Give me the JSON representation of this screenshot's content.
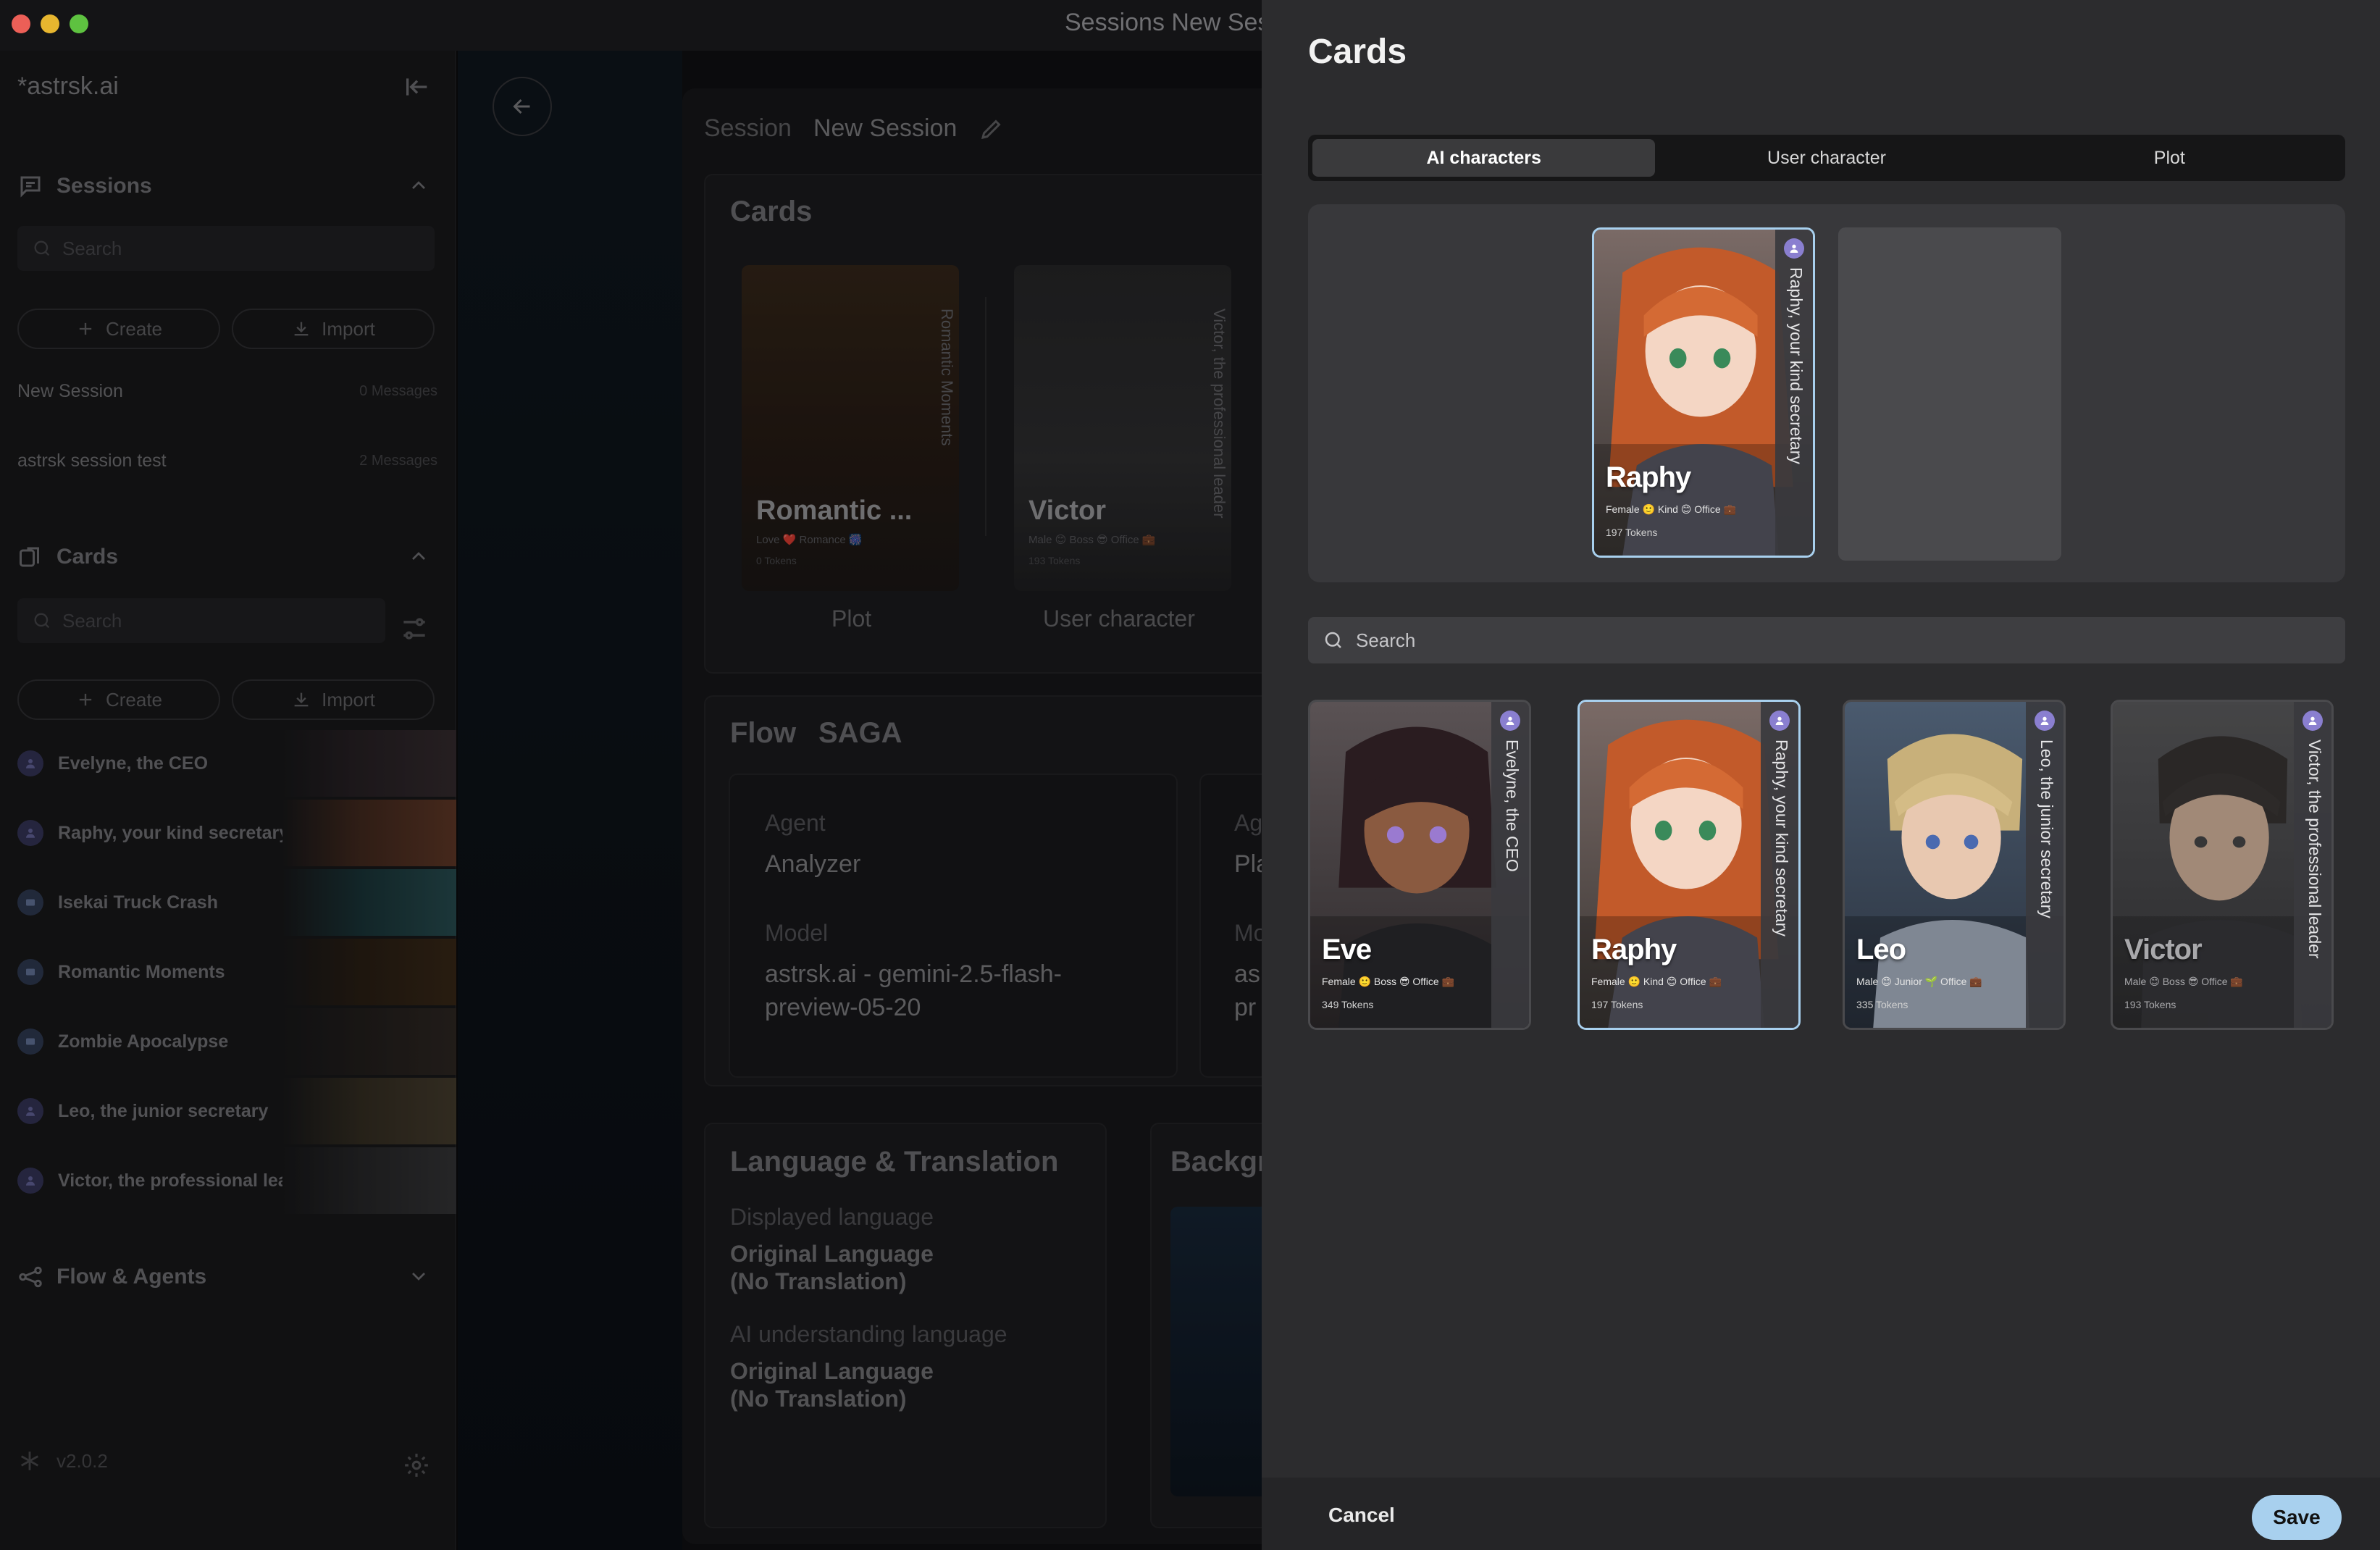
{
  "window": {
    "title": "Sessions  New Session"
  },
  "sidebar": {
    "logo": "*astrsk.ai",
    "sessions": {
      "title": "Sessions",
      "search_placeholder": "Search",
      "create_label": "Create",
      "import_label": "Import",
      "items": [
        {
          "name": "New Session",
          "count": "0 Messages"
        },
        {
          "name": "astrsk session test",
          "count": "2 Messages"
        }
      ]
    },
    "cards": {
      "title": "Cards",
      "search_placeholder": "Search",
      "create_label": "Create",
      "import_label": "Import",
      "items": [
        {
          "name": "Evelyne, the CEO"
        },
        {
          "name": "Raphy, your kind secretary"
        },
        {
          "name": "Isekai Truck Crash"
        },
        {
          "name": "Romantic Moments"
        },
        {
          "name": "Zombie Apocalypse"
        },
        {
          "name": "Leo, the junior secretary"
        },
        {
          "name": "Victor, the professional leader"
        }
      ]
    },
    "flow": {
      "title": "Flow & Agents"
    },
    "version": "v2.0.2"
  },
  "session": {
    "breadcrumb": {
      "first": "Session",
      "second": "New Session"
    },
    "cards_title": "Cards",
    "plot_card": {
      "name": "Romantic ...",
      "tags": "Love ❤️ Romance 🎆",
      "tokens": "0 Tokens",
      "vertical": "Romantic Moments",
      "label": "Plot"
    },
    "user_card": {
      "name": "Victor",
      "tags": "Male 😊 Boss 😎 Office 💼",
      "tokens": "193 Tokens",
      "vertical": "Victor, the professional leader",
      "label": "User character"
    },
    "flow_title": "Flow",
    "flow_name": "SAGA",
    "agent_label": "Agent",
    "agent_value": "Analyzer",
    "agent2_label": "Ag",
    "agent2_value": "Pla",
    "model_label": "Model",
    "model_value": "astrsk.ai - gemini-2.5-flash-preview-05-20",
    "model2_label": "Mo",
    "model2_value": "as pr",
    "lang_title": "Language & Translation",
    "displayed_label": "Displayed language",
    "displayed_value": "Original Language (No Translation)",
    "ai_label": "AI understanding language",
    "ai_value": "Original Language (No Translation)",
    "background_title": "Backgr"
  },
  "modal": {
    "title": "Cards",
    "tabs": [
      {
        "label": "AI characters",
        "active": true
      },
      {
        "label": "User character",
        "active": false
      },
      {
        "label": "Plot",
        "active": false
      }
    ],
    "selected": [
      {
        "name": "Raphy",
        "vertical": "Raphy, your kind secretary",
        "tags": "Female 🙂 Kind 😊 Office 💼",
        "tokens": "197 Tokens"
      }
    ],
    "search_placeholder": "Search",
    "cards": [
      {
        "name": "Eve",
        "vertical": "Evelyne, the CEO",
        "tags": "Female 🙂 Boss 😎 Office 💼",
        "tokens": "349 Tokens",
        "selected": false
      },
      {
        "name": "Raphy",
        "vertical": "Raphy, your kind secretary",
        "tags": "Female 🙂 Kind 😊 Office 💼",
        "tokens": "197 Tokens",
        "selected": true
      },
      {
        "name": "Leo",
        "vertical": "Leo, the junior secretary",
        "tags": "Male 😊 Junior 🌱 Office 💼",
        "tokens": "335 Tokens",
        "selected": false
      },
      {
        "name": "Victor",
        "vertical": "Victor, the professional leader",
        "tags": "Male 😊 Boss 😎 Office 💼",
        "tokens": "193 Tokens",
        "selected": false
      }
    ],
    "cancel_label": "Cancel",
    "save_label": "Save"
  }
}
